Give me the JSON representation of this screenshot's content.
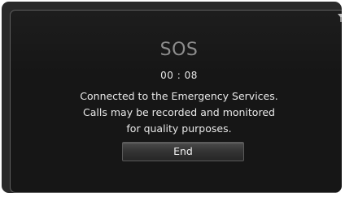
{
  "sos_screen": {
    "title": "SOS",
    "timer": "00 : 08",
    "message_lines": [
      "Connected to the Emergency Services.",
      "Calls may be recorded and monitored",
      "for quality purposes."
    ],
    "end_button_label": "End"
  },
  "status_bar": {
    "signal_icon": "signal-antenna-icon"
  },
  "colors": {
    "background": "#161616",
    "frame": "#2a2a2a",
    "title_text": "#8d8d8d",
    "body_text": "#e8e8e8"
  }
}
